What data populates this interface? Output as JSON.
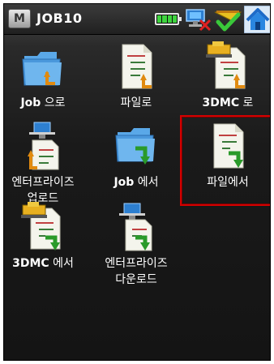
{
  "window": {
    "menu_button": "M",
    "title": "JOB10"
  },
  "status_icons": [
    "battery-icon",
    "network-icon",
    "satellite-fix-icon",
    "home-icon"
  ],
  "tiles": [
    {
      "label_bold": "Job",
      "label_rest": " 으로",
      "icon": "folder-import-icon"
    },
    {
      "label_bold": "",
      "label_rest": "파일로",
      "icon": "file-import-icon"
    },
    {
      "label_bold": "3DMC",
      "label_rest": " 로",
      "icon": "3dmc-import-icon"
    },
    {
      "label_bold": "",
      "label_rest": "엔터프라이즈\n업로드",
      "icon": "enterprise-upload-icon"
    },
    {
      "label_bold": "Job",
      "label_rest": " 에서",
      "icon": "folder-export-icon"
    },
    {
      "label_bold": "",
      "label_rest": "파일에서",
      "icon": "file-export-icon"
    },
    {
      "label_bold": "3DMC",
      "label_rest": " 에서",
      "icon": "3dmc-export-icon"
    },
    {
      "label_bold": "",
      "label_rest": "엔터프라이즈\n다운로드",
      "icon": "enterprise-download-icon"
    }
  ],
  "selected_tile": "파일에서",
  "colors": {
    "selection": "#d30000",
    "background": "#1a1a1a",
    "text": "#ffffff"
  }
}
